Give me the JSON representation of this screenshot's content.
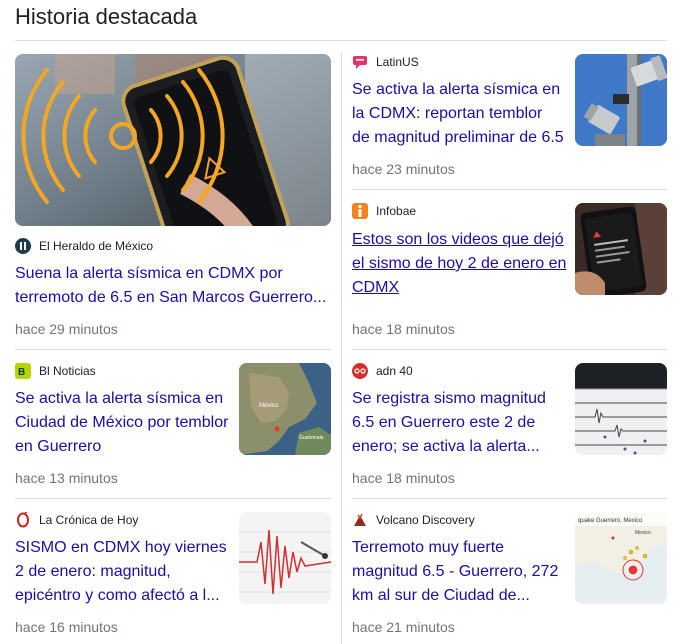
{
  "page_title": "Historia destacada",
  "stories": [
    {
      "source": "El Heraldo de México",
      "headline": "Suena la alerta sísmica en CDMX por terremoto de 6.5 en San Marcos Guerrero...",
      "time": "hace 29 minutos",
      "thumb": "phone-alert-image",
      "colors": {
        "icon_bg": "#1f3a4d"
      }
    },
    {
      "source": "LatinUS",
      "headline": "Se activa la alerta sísmica en la CDMX: reportan temblor de magnitud preliminar de 6.5",
      "time": "hace 23 minutos",
      "thumb": "loudspeaker-image",
      "colors": {
        "icon_bg": "#e8336d"
      }
    },
    {
      "source": "Infobae",
      "headline": "Estos son los videos que dejó el sismo de hoy 2 de enero en CDMX",
      "time": "hace 18 minutos",
      "thumb": "phone-screen-image",
      "colors": {
        "icon_bg": "#f5821f"
      }
    },
    {
      "source": "Bl Noticias",
      "headline": "Se activa la alerta sísmica en Ciudad de México por temblor en Guerrero",
      "time": "hace 13 minutos",
      "thumb": "map-image",
      "colors": {
        "icon_bg": "#b5d400"
      }
    },
    {
      "source": "adn 40",
      "headline": "Se registra sismo magnitud 6.5 en Guerrero este 2 de enero; se activa la alerta...",
      "time": "hace 18 minutos",
      "thumb": "seismograph-image",
      "colors": {
        "icon_bg": "#d32f2f"
      }
    },
    {
      "source": "La Crónica de Hoy",
      "headline": "SISMO en CDMX hoy viernes 2 de enero: magnitud, epicéntro y como afectó a l...",
      "time": "hace 16 minutos",
      "thumb": "seismograph-red-image",
      "colors": {
        "icon_bg": "#ffffff"
      }
    },
    {
      "source": "Volcano Discovery",
      "headline": "Terremoto muy fuerte magnitud 6.5 - Guerrero, 272 km al sur de Ciudad de...",
      "time": "hace 21 minutos",
      "thumb": "quake-map-image",
      "colors": {
        "icon_bg": "#ffffff"
      }
    }
  ],
  "thumb_text": {
    "map_label": "México",
    "map_label2": "Guatemala",
    "quake_map_title": "quake Guerrero, Mexico",
    "quake_map_label": "Mexico"
  }
}
